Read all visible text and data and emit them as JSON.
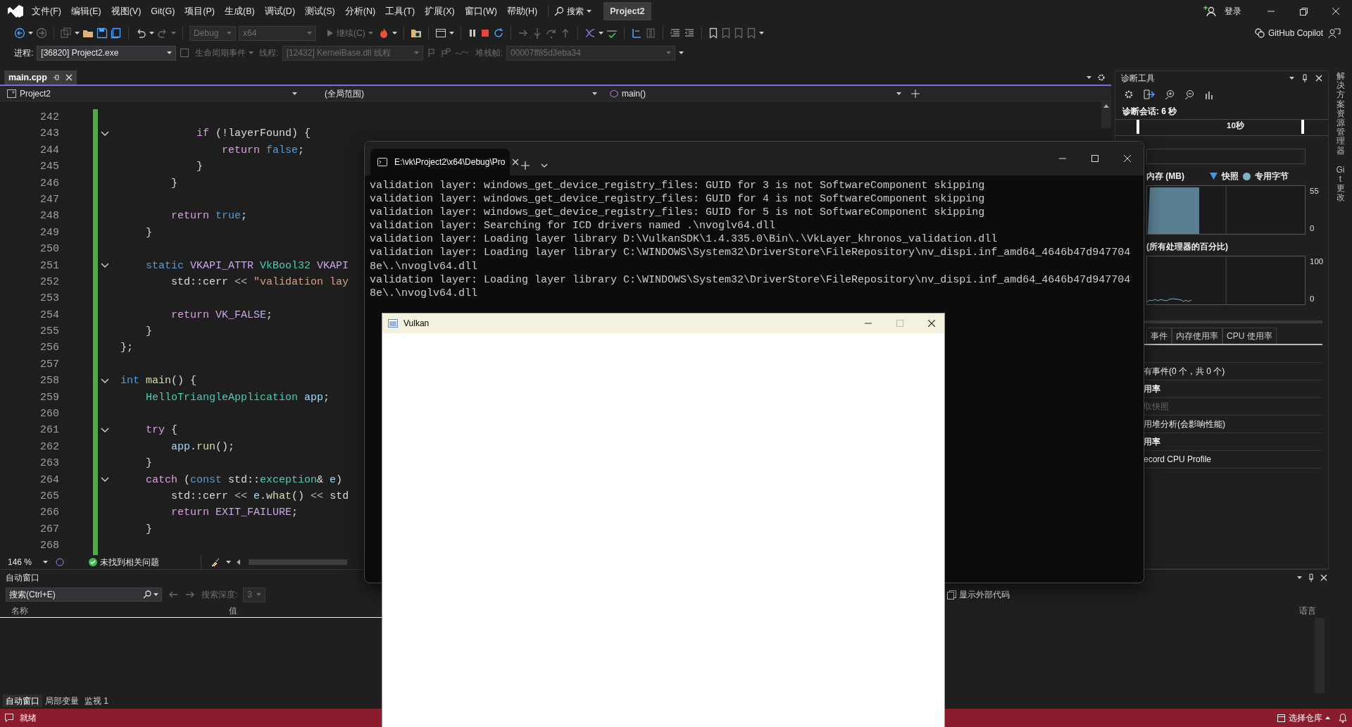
{
  "menu": [
    "文件(F)",
    "编辑(E)",
    "视图(V)",
    "Git(G)",
    "项目(P)",
    "生成(B)",
    "调试(D)",
    "测试(S)",
    "分析(N)",
    "工具(T)",
    "扩展(X)",
    "窗口(W)",
    "帮助(H)"
  ],
  "search_menu": "搜索",
  "solution": "Project2",
  "sign_in": "登录",
  "copilot": "GitHub Copilot",
  "toolbar": {
    "config": {
      "value": "Debug",
      "disabled": true
    },
    "platform": {
      "value": "x64",
      "disabled": true
    },
    "continue": {
      "label": "继续(C)",
      "disabled": true
    }
  },
  "debug_bar": {
    "process_label": "进程:",
    "process": "[36820] Project2.exe",
    "lifecycle": {
      "label": "生命周期事件",
      "disabled": true
    },
    "thread_label": "线程:",
    "thread": {
      "value": "[12432] KernelBase.dll 线程",
      "disabled": true
    },
    "stack_label": "堆栈帧:",
    "stack": {
      "value": "00007ff85d3eba34",
      "disabled": true
    }
  },
  "editor": {
    "tabs": [
      {
        "label": "main.cpp",
        "selected": true
      }
    ],
    "nav": {
      "project": "Project2",
      "scope": "(全局范围)",
      "member": "main()"
    },
    "lines": [
      {
        "number": "242",
        "foldable": false
      },
      {
        "number": "243",
        "foldable": true,
        "tokens": [
          {
            "kind": "ctrl",
            "text": "            if"
          },
          {
            "kind": "plain",
            "text": " (!layerFound) {"
          }
        ]
      },
      {
        "number": "244",
        "foldable": false,
        "tokens": [
          {
            "kind": "ctrl",
            "text": "                return"
          },
          {
            "kind": "kw",
            "text": " false"
          },
          {
            "kind": "plain",
            "text": ";"
          }
        ]
      },
      {
        "number": "245",
        "foldable": false,
        "tokens": [
          {
            "kind": "plain",
            "text": "            }"
          }
        ]
      },
      {
        "number": "246",
        "foldable": false,
        "tokens": [
          {
            "kind": "plain",
            "text": "        }"
          }
        ]
      },
      {
        "number": "247",
        "foldable": false
      },
      {
        "number": "248",
        "foldable": false,
        "tokens": [
          {
            "kind": "ctrl",
            "text": "        return"
          },
          {
            "kind": "kw",
            "text": " true"
          },
          {
            "kind": "plain",
            "text": ";"
          }
        ]
      },
      {
        "number": "249",
        "foldable": false,
        "tokens": [
          {
            "kind": "plain",
            "text": "    }"
          }
        ]
      },
      {
        "number": "250",
        "foldable": false
      },
      {
        "number": "251",
        "foldable": true,
        "tokens": [
          {
            "kind": "kw",
            "text": "    static"
          },
          {
            "kind": "macro",
            "text": " VKAPI_ATTR"
          },
          {
            "kind": "type",
            "text": " VkBool32"
          },
          {
            "kind": "macro",
            "text": " VKAPI"
          }
        ]
      },
      {
        "number": "252",
        "foldable": false,
        "tokens": [
          {
            "kind": "plain",
            "text": "        std::cerr "
          },
          {
            "kind": "op",
            "text": "<<"
          },
          {
            "kind": "str",
            "text": " \"validation lay"
          }
        ]
      },
      {
        "number": "253",
        "foldable": false
      },
      {
        "number": "254",
        "foldable": false,
        "tokens": [
          {
            "kind": "ctrl",
            "text": "        return"
          },
          {
            "kind": "macro",
            "text": " VK_FALSE"
          },
          {
            "kind": "plain",
            "text": ";"
          }
        ]
      },
      {
        "number": "255",
        "foldable": false,
        "tokens": [
          {
            "kind": "plain",
            "text": "    }"
          }
        ]
      },
      {
        "number": "256",
        "foldable": false,
        "tokens": [
          {
            "kind": "plain",
            "text": "};"
          }
        ]
      },
      {
        "number": "257",
        "foldable": false
      },
      {
        "number": "258",
        "foldable": true,
        "tokens": [
          {
            "kind": "kw",
            "text": "int"
          },
          {
            "kind": "fn",
            "text": " main"
          },
          {
            "kind": "plain",
            "text": "() {"
          }
        ]
      },
      {
        "number": "259",
        "foldable": false,
        "tokens": [
          {
            "kind": "type",
            "text": "    HelloTriangleApplication"
          },
          {
            "kind": "var",
            "text": " app"
          },
          {
            "kind": "plain",
            "text": ";"
          }
        ]
      },
      {
        "number": "260",
        "foldable": false
      },
      {
        "number": "261",
        "foldable": true,
        "tokens": [
          {
            "kind": "ctrl",
            "text": "    try"
          },
          {
            "kind": "plain",
            "text": " {"
          }
        ]
      },
      {
        "number": "262",
        "foldable": false,
        "tokens": [
          {
            "kind": "var",
            "text": "        app"
          },
          {
            "kind": "plain",
            "text": "."
          },
          {
            "kind": "fn",
            "text": "run"
          },
          {
            "kind": "plain",
            "text": "();"
          }
        ]
      },
      {
        "number": "263",
        "foldable": false,
        "tokens": [
          {
            "kind": "plain",
            "text": "    }"
          }
        ]
      },
      {
        "number": "264",
        "foldable": true,
        "tokens": [
          {
            "kind": "ctrl",
            "text": "    catch"
          },
          {
            "kind": "plain",
            "text": " ("
          },
          {
            "kind": "kw",
            "text": "const"
          },
          {
            "kind": "plain",
            "text": " std::"
          },
          {
            "kind": "type",
            "text": "exception"
          },
          {
            "kind": "plain",
            "text": "& "
          },
          {
            "kind": "var",
            "text": "e"
          },
          {
            "kind": "plain",
            "text": ")"
          }
        ]
      },
      {
        "number": "265",
        "foldable": false,
        "tokens": [
          {
            "kind": "plain",
            "text": "        std::cerr "
          },
          {
            "kind": "op",
            "text": "<<"
          },
          {
            "kind": "var",
            "text": " e"
          },
          {
            "kind": "plain",
            "text": "."
          },
          {
            "kind": "fn",
            "text": "what"
          },
          {
            "kind": "plain",
            "text": "() "
          },
          {
            "kind": "op",
            "text": "<<"
          },
          {
            "kind": "plain",
            "text": " std"
          }
        ]
      },
      {
        "number": "266",
        "foldable": false,
        "tokens": [
          {
            "kind": "ctrl",
            "text": "        return"
          },
          {
            "kind": "macro",
            "text": " EXIT_FAILURE"
          },
          {
            "kind": "plain",
            "text": ";"
          }
        ]
      },
      {
        "number": "267",
        "foldable": false,
        "tokens": [
          {
            "kind": "plain",
            "text": "    }"
          }
        ]
      },
      {
        "number": "268",
        "foldable": false
      }
    ],
    "zoom": "146 %",
    "issues": "未找到相关问题"
  },
  "terminal": {
    "title": "E:\\vk\\Project2\\x64\\Debug\\Pro",
    "lines": [
      "validation layer: windows_get_device_registry_files: GUID for 3 is not SoftwareComponent skipping",
      "validation layer: windows_get_device_registry_files: GUID for 4 is not SoftwareComponent skipping",
      "validation layer: windows_get_device_registry_files: GUID for 5 is not SoftwareComponent skipping",
      "validation layer: Searching for ICD drivers named .\\nvoglv64.dll",
      "validation layer: Loading layer library D:\\VulkanSDK\\1.4.335.0\\Bin\\.\\VkLayer_khronos_validation.dll",
      "validation layer: Loading layer library C:\\WINDOWS\\System32\\DriverStore\\FileRepository\\nv_dispi.inf_amd64_4646b47d947704",
      "8e\\.\\nvoglv64.dll",
      "validation layer: Loading layer library C:\\WINDOWS\\System32\\DriverStore\\FileRepository\\nv_dispi.inf_amd64_4646b47d947704",
      "8e\\.\\nvoglv64.dll"
    ]
  },
  "vulkan_window": {
    "title": "Vulkan"
  },
  "diagnostics": {
    "title": "诊断工具",
    "session": "诊断会话: 6 秒",
    "timeline_label": "10秒",
    "memory": {
      "title": "内存 (MB)",
      "snapshot": "快照",
      "private_bytes": "专用字节",
      "max": "55",
      "min": "0"
    },
    "cpu": {
      "title": "(所有处理器的百分比)",
      "max": "100",
      "min": "0"
    },
    "tabs": [
      "事件",
      "内存使用率",
      "CPU 使用率"
    ],
    "rows": [
      {
        "kind": "item",
        "text": "有事件(0 个，共 0 个)"
      },
      {
        "kind": "heading",
        "text": "用率"
      },
      {
        "kind": "disabled",
        "text": "取快照"
      },
      {
        "kind": "item",
        "text": "用堆分析(会影响性能)"
      },
      {
        "kind": "heading",
        "text": "用率"
      },
      {
        "kind": "item",
        "text": "ecord CPU Profile"
      }
    ]
  },
  "side_tabs": [
    "解决方案资源管理器",
    "Git 更改"
  ],
  "autos": {
    "title": "自动窗口",
    "search_placeholder": "搜索(Ctrl+E)",
    "depth_label": "搜索深度:",
    "depth": {
      "value": "3",
      "disabled": true
    },
    "external_code": "显示外部代码",
    "columns": [
      "名称",
      "值",
      "语言"
    ],
    "tabs": [
      {
        "label": "自动窗口",
        "selected": true
      },
      {
        "label": "局部变量",
        "selected": false
      },
      {
        "label": "监视 1",
        "selected": false
      }
    ]
  },
  "status": {
    "text": "就绪",
    "repo": "选择仓库"
  }
}
